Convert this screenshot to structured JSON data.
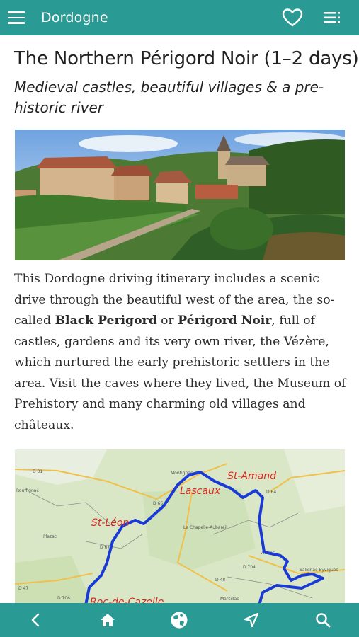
{
  "header": {
    "title": "Dordogne",
    "menu_icon": "hamburger-menu-icon",
    "favorite_icon": "heart-icon",
    "toc_icon": "list-icon"
  },
  "article": {
    "title": "The Northern Périgord Noir (1–2 days)",
    "subtitle": "Medieval castles, beautiful villages & a pre-historic river",
    "body": {
      "p1": "This Dordogne driving itinerary includes a scenic drive through the beautiful west of the area, the so-called ",
      "bold1": "Black Perigord",
      "or": " or ",
      "bold2": "Périgord Noir",
      "p2": ", full of castles, gardens and its very own river, the Vézère, which nurtured the early prehistoric settlers in the area. Visit the caves where they lived, the Museum of Prehistory and many charming old villages and châteaux."
    }
  },
  "map": {
    "labels": {
      "st_amand": "St-Amand",
      "lascaux": "Lascaux",
      "st_leon": "St-Léon",
      "roc": "Roc-de-Cazelle"
    },
    "road_labels": {
      "d31": "D 31",
      "d47": "D 47",
      "d67": "D 67",
      "d704": "D 704",
      "d48": "D 48",
      "d64": "D 64",
      "d66": "D 66",
      "d706": "D 706"
    },
    "place_labels": {
      "rouffignac": "Rouffignac",
      "plazac": "Plazac",
      "chapelle": "La Chapelle-Aubareil",
      "montignac": "Montignac",
      "salignac": "Salignac-Eyvigues",
      "auriac": "Auriac",
      "marcillac": "Marcillac"
    },
    "route_color": "#1a3ad6",
    "label_color": "#e0241e"
  },
  "bottom_nav": {
    "items": [
      "back-icon",
      "home-icon",
      "globe-icon",
      "location-arrow-icon",
      "search-icon"
    ]
  },
  "colors": {
    "accent": "#2a9a94"
  }
}
